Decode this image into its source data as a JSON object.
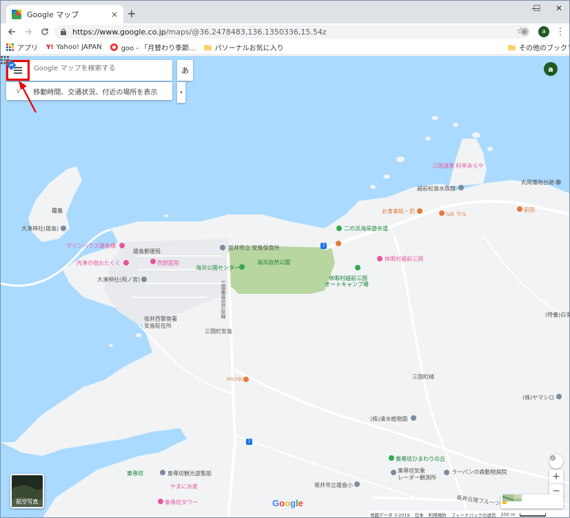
{
  "browser": {
    "tab_title": "Google マップ",
    "tab_close": "×",
    "new_tab": "+",
    "window_controls": {
      "minimize": "—",
      "maximize": "☐",
      "close": "✕"
    },
    "url_host": "https://www.google.co.jp",
    "url_path": "/maps/@36.2478483,136.1350336,15.54z",
    "profile_initial": "a"
  },
  "bookmarks": {
    "items": [
      {
        "label": "アプリ",
        "icon": "apps-grid-icon"
      },
      {
        "label": "Yahoo! JAPAN",
        "icon": "yahoo-icon"
      },
      {
        "label": "goo - 「月替わり季節...",
        "icon": "goo-icon"
      },
      {
        "label": "パソーナルお気に入り",
        "icon": "folder-icon"
      }
    ],
    "other": "その他のブックマーク"
  },
  "maps": {
    "search_placeholder": "Google マップを検索する",
    "hint_text": "移動時間、交通状況、付近の場所を表示",
    "ime_label": "あ",
    "account_initial": "a",
    "satellite_label": "航空写真",
    "logo": "Google",
    "zoom_in": "+",
    "zoom_out": "−",
    "footer": {
      "data": "地図データ ©2019",
      "country": "日本",
      "terms": "利用規約",
      "feedback": "フィードバックの送信",
      "scale": "200 m"
    }
  },
  "places": {
    "ojima": "雄島",
    "ojima_shrine": "大湊神社(雄島)",
    "marine_house": "マリンハウス雄島橋",
    "uchiura": "内湊の宿おたくく",
    "ojima_post": "雄島郵便局",
    "nishino": "西野医院",
    "ominato_shrine": "大湊神社(飛ノ宮)",
    "sakai_nursery": "坂井市立 安島保育所",
    "kaihama_center": "海浜公園センター",
    "kaihama_park": "海浜自然公園",
    "sakai_police": "坂井西警察署",
    "ajima_koban": "安島駐在所",
    "mikuni_ajima": "三国町安島",
    "road_label": "三国東尋坊芦原線",
    "mikuni_onsen": "三国温泉 料亭あらや",
    "maruoka": "丸岡藩砲台跡",
    "matsushima": "越前松島水族館",
    "oshokuji": "お食事処・釣",
    "rula": "lull ラル",
    "maeda": "前田",
    "promenade": "二の浜海岸遊歩道",
    "kyukamura": "休暇村越前三国",
    "camp1": "休暇村越前三国",
    "camp2": "オートキャンプ場",
    "tokubetsu": "(特養)白楽",
    "mikuni_town": "三国町崎",
    "mcnic": "mcnic",
    "yamashiro": "(株)ヤマシロ",
    "shimizu": "(株)清水植物園",
    "himawari": "東尋坊ひまわりの丘",
    "tojinbo": "東尋坊",
    "tojinbo_ship": "東尋坊観光遊覧船",
    "yamani": "やまに水産",
    "tojinbo_tower": "東尋坊タワー",
    "radar1": "東尋坊気象",
    "radar2": "レーダー観測所",
    "oshima_school": "坂井市立雄島小",
    "raabaan": "ラーパンの森動物病院",
    "flower_road": "坂井丘陵フルーツライン"
  }
}
